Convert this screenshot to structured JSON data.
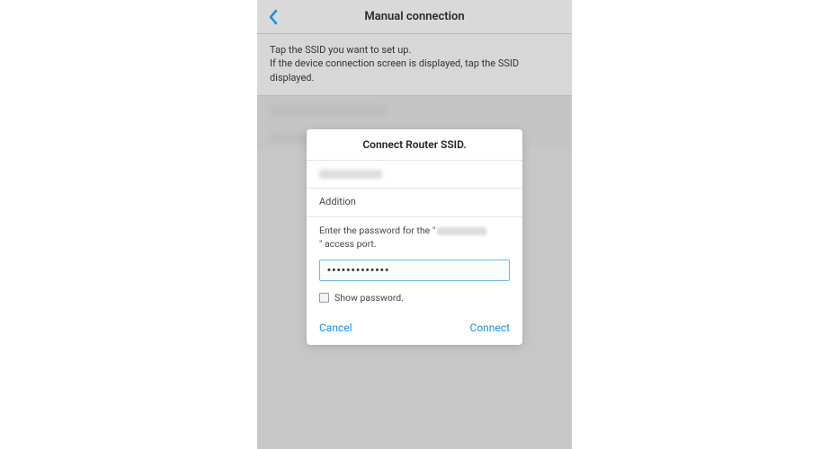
{
  "header": {
    "title": "Manual connection"
  },
  "instruction": {
    "line1": "Tap the SSID you want to set up.",
    "line2": "If the device connection screen is displayed, tap the SSID displayed."
  },
  "dialog": {
    "title": "Connect Router SSID.",
    "addition_label": "Addition",
    "prompt_prefix": "Enter the password for the \"",
    "prompt_suffix": "\" access port.",
    "password_value": "•••••••••••••",
    "show_password_label": "Show password.",
    "cancel_label": "Cancel",
    "connect_label": "Connect"
  }
}
